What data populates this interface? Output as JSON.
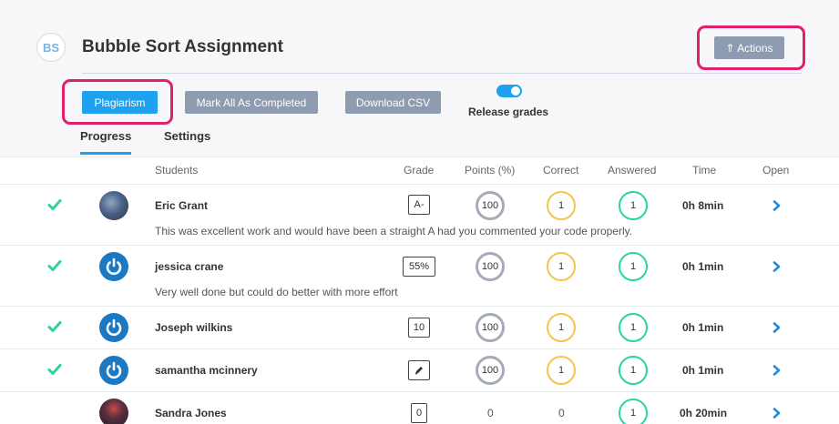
{
  "header": {
    "initials": "BS",
    "title": "Bubble Sort Assignment",
    "actions_label": "⇑ Actions"
  },
  "toolbar": {
    "plagiarism_label": "Plagiarism",
    "mark_completed_label": "Mark All As Completed",
    "download_csv_label": "Download CSV",
    "release_grades_label": "Release grades",
    "release_grades_on": true
  },
  "tabs": [
    {
      "label": "Progress",
      "active": true
    },
    {
      "label": "Settings",
      "active": false
    }
  ],
  "columns": {
    "students": "Students",
    "grade": "Grade",
    "points": "Points (%)",
    "correct": "Correct",
    "answered": "Answered",
    "time": "Time",
    "open": "Open"
  },
  "rows": [
    {
      "completed": true,
      "avatar": "photo",
      "name": "Eric Grant",
      "grade": "A-",
      "points": "100",
      "correct": "1",
      "answered": "1",
      "time": "0h 8min",
      "comment": "This was excellent work and would have been a straight A had you commented your code properly."
    },
    {
      "completed": true,
      "avatar": "power-icon",
      "name": "jessica crane",
      "grade": "55%",
      "points": "100",
      "correct": "1",
      "answered": "1",
      "time": "0h 1min",
      "comment": "Very well done but could do better with more effort"
    },
    {
      "completed": true,
      "avatar": "power-icon",
      "name": "Joseph wilkins",
      "grade": "10",
      "points": "100",
      "correct": "1",
      "answered": "1",
      "time": "0h 1min"
    },
    {
      "completed": true,
      "avatar": "power-icon",
      "name": "samantha mcinnery",
      "grade_icon": "pen-icon",
      "points": "100",
      "correct": "1",
      "answered": "1",
      "time": "0h 1min"
    },
    {
      "completed": false,
      "avatar": "photo",
      "name": "Sandra Jones",
      "grade": "0",
      "points": "0",
      "correct": "0",
      "answered": "1",
      "time": "0h 20min"
    }
  ],
  "colors": {
    "accent": "#1ea2ef",
    "grey_button": "#8e9bb0",
    "highlight": "#e0206a",
    "check_green": "#2dd1a5",
    "correct_ring": "#f2c54f",
    "points_ring": "#a4acb8"
  }
}
